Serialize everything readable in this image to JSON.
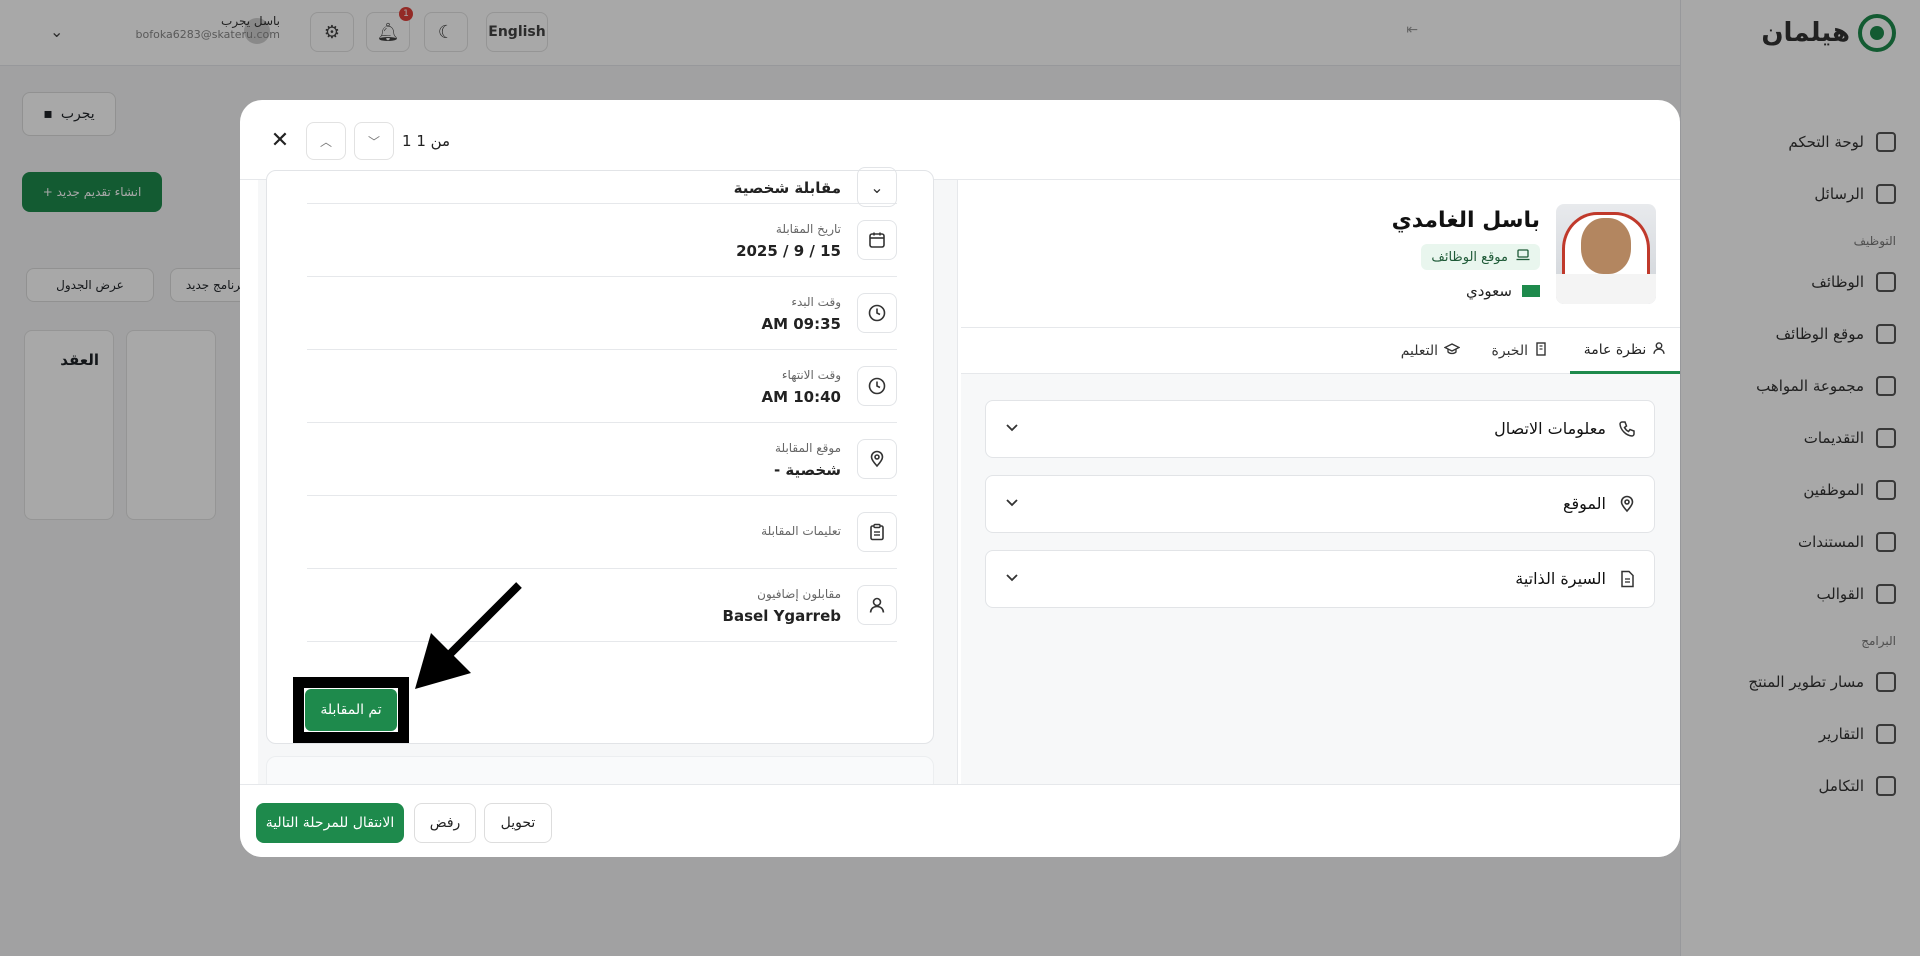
{
  "app": {
    "logo_text": "هيلمان",
    "nav": {
      "items_top": [
        "لوحة التحكم",
        "الرسائل"
      ],
      "section_hiring": "التوظيف",
      "items_hiring": [
        "الوظائف",
        "موقع الوظائف",
        "مجموعة المواهب",
        "التقديمات",
        "الموظفين",
        "المستندات",
        "القوالب"
      ],
      "section_programs": "البرامج",
      "items_programs": [
        "مسار تطوير المنتج",
        "التقارير",
        "التكامل"
      ]
    },
    "topbar": {
      "language": "English",
      "notifications_count": "1",
      "user_name": "باسل يجرب",
      "user_email": "bofoka6283@skateru.com"
    },
    "page": {
      "draft_label": "يجرب",
      "new_application_label": "+ انشاء تقديم جديد",
      "view_table_label": "عرض الجدول",
      "schedule_label": "برنامج جديد",
      "column_title": "العقد"
    }
  },
  "modal": {
    "counter": "1 من 1",
    "interview": {
      "partial_value": "مقابلة شخصية",
      "rows": [
        {
          "label": "تاريخ المقابلة",
          "value": "15 / 9 / 2025",
          "icon": "calendar-icon"
        },
        {
          "label": "وقت البدء",
          "value": "AM 09:35",
          "icon": "clock-icon"
        },
        {
          "label": "وقت الانتهاء",
          "value": "AM 10:40",
          "icon": "clock-icon"
        },
        {
          "label": "موقع المقابلة",
          "value": "شخصية -",
          "icon": "map-pin-icon"
        },
        {
          "label": "تعليمات المقابلة",
          "value": "",
          "icon": "clipboard-icon"
        },
        {
          "label": "مقابلون إضافيون",
          "value": "Basel Ygarreb",
          "icon": "user-icon"
        }
      ],
      "done_button": "تم المقابلة"
    },
    "profile": {
      "name": "باسل الغامدي",
      "source": "موقع الوظائف",
      "nationality": "سعودي"
    },
    "tabs": [
      {
        "label": "نظرة عامة",
        "icon": "user-icon",
        "active": true
      },
      {
        "label": "الخبرة",
        "icon": "building-icon",
        "active": false
      },
      {
        "label": "التعليم",
        "icon": "graduation-cap-icon",
        "active": false
      }
    ],
    "accordions": [
      {
        "title": "معلومات الاتصال",
        "icon": "phone-icon"
      },
      {
        "title": "الموقع",
        "icon": "map-pin-icon"
      },
      {
        "title": "السيرة الذاتية",
        "icon": "file-icon"
      }
    ],
    "footer": {
      "next_stage": "الانتقال للمرحلة التالية",
      "reject": "رفض",
      "transfer": "تحويل"
    }
  },
  "colors": {
    "primary": "#1e8a4c",
    "badge": "#e0413a"
  }
}
